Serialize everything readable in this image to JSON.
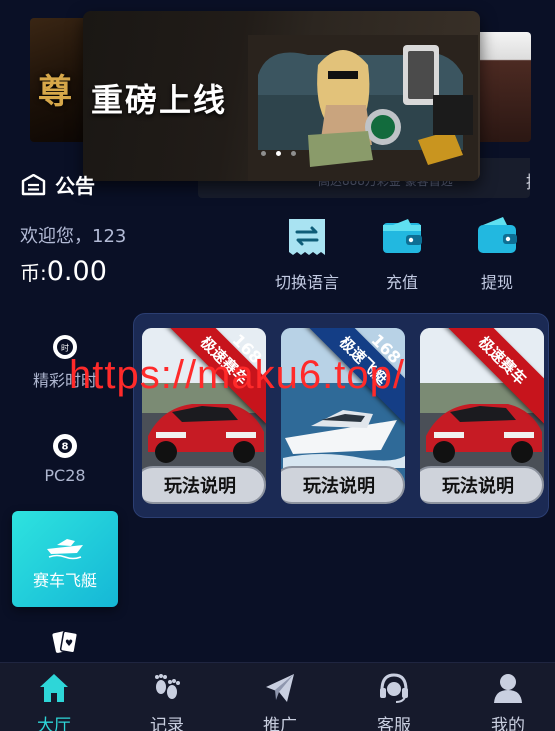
{
  "banner": {
    "title": "重磅上线",
    "left_glyph": "尊",
    "caption": "高达888万彩金 豪客首选",
    "caption_tail": "揄",
    "slides": 3,
    "active_slide": 2
  },
  "notice": {
    "label": "公告"
  },
  "user": {
    "welcome": "欢迎您，123",
    "currency_symbol": "币:",
    "balance": "0.00"
  },
  "actions": [
    {
      "label": "切换语言",
      "icon": "language-switch-icon"
    },
    {
      "label": "充值",
      "icon": "wallet-icon"
    },
    {
      "label": "提现",
      "icon": "withdraw-wallet-icon"
    }
  ],
  "categories": [
    {
      "label": "精彩时时",
      "icon": "shishi-ball-icon"
    },
    {
      "label": "PC28",
      "icon": "eight-ball-icon"
    },
    {
      "label": "赛车飞艇",
      "icon": "speedboat-icon",
      "active": true
    },
    {
      "label": "",
      "icon": "playing-cards-icon"
    }
  ],
  "games": [
    {
      "ribbon": "极速赛车",
      "ribbon_num": "168",
      "button": "玩法说明",
      "theme": "car"
    },
    {
      "ribbon": "极速飞艇",
      "ribbon_num": "168",
      "button": "玩法说明",
      "theme": "boat"
    },
    {
      "ribbon": "极速赛车",
      "ribbon_num": "",
      "button": "玩法说明",
      "theme": "car"
    }
  ],
  "watermark": "https://maku6.top/",
  "tabs": [
    {
      "label": "大厅",
      "icon": "home-icon",
      "active": true
    },
    {
      "label": "记录",
      "icon": "footprints-icon"
    },
    {
      "label": "推广",
      "icon": "paper-plane-icon"
    },
    {
      "label": "客服",
      "icon": "headset-icon"
    },
    {
      "label": "我的",
      "icon": "user-icon"
    }
  ],
  "colors": {
    "background": "#0a1026",
    "accent": "#2ed6d8",
    "panel": "#1b2a54",
    "ribbon_red": "#c7141c",
    "ribbon_blue": "#143e86",
    "watermark": "#ff2a2a"
  }
}
